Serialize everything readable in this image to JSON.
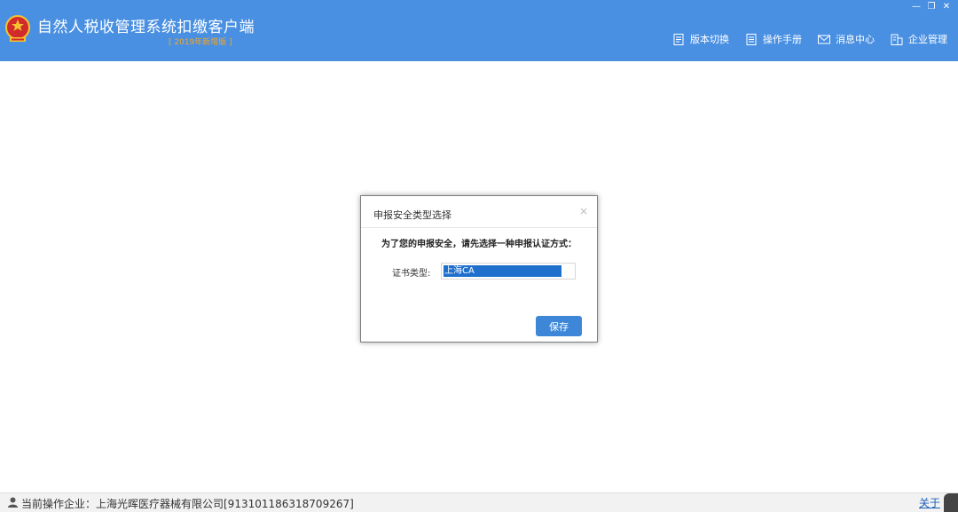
{
  "app": {
    "title": "自然人税收管理系统扣缴客户端",
    "version": "[ 2019年新增版 ]"
  },
  "window_controls": {
    "minimize": "—",
    "maximize": "❐",
    "close": "✕"
  },
  "nav": {
    "version_switch": "版本切换",
    "manual": "操作手册",
    "messages": "消息中心",
    "enterprise": "企业管理"
  },
  "dialog": {
    "title": "申报安全类型选择",
    "close": "×",
    "prompt": "为了您的申报安全，请先选择一种申报认证方式：",
    "cert_label": "证书类型:",
    "cert_value": "上海CA",
    "save": "保存"
  },
  "status": {
    "current_enterprise": "当前操作企业：上海光晖医疗器械有限公司[913101186318709267]",
    "about": "关于"
  },
  "colors": {
    "header": "#4a90e2",
    "accent": "#3e87d8",
    "version_text": "#f5a623"
  }
}
